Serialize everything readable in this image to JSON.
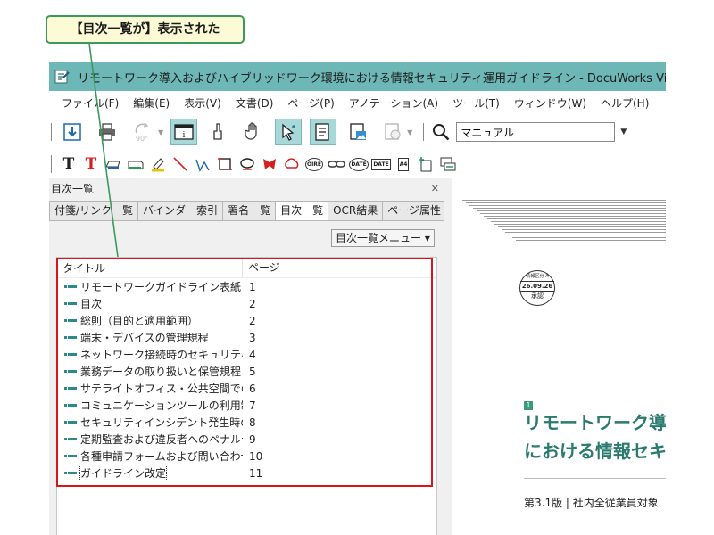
{
  "callout": {
    "text": "【目次一覧が】表示された"
  },
  "window": {
    "title": "リモートワーク導入およびハイブリッドワーク環境における情報セキュリティ運用ガイドライン - DocuWorks Viewer"
  },
  "menu": [
    {
      "label": "ファイル(F)"
    },
    {
      "label": "編集(E)"
    },
    {
      "label": "表示(V)"
    },
    {
      "label": "文書(D)"
    },
    {
      "label": "ページ(P)"
    },
    {
      "label": "アノテーション(A)"
    },
    {
      "label": "ツール(T)"
    },
    {
      "label": "ウィンドウ(W)"
    },
    {
      "label": "ヘルプ(H)"
    }
  ],
  "toolbar": {
    "rotate_label": "90°",
    "search_value": "マニュアル"
  },
  "annotation_toolbar": {
    "text_tool_1": "T",
    "text_tool_2": "T",
    "stamp_1": "OIRE",
    "stamp_2": "DATE",
    "stamp_3": "DATE",
    "paper_size": "A4"
  },
  "panel": {
    "title": "目次一覧",
    "close_glyph": "✕",
    "tabs": [
      {
        "label": "付箋/リンク一覧"
      },
      {
        "label": "バインダー索引"
      },
      {
        "label": "署名一覧"
      },
      {
        "label": "目次一覧"
      },
      {
        "label": "OCR結果"
      },
      {
        "label": "ページ属性"
      }
    ],
    "menu_button": "目次一覧メニュー ▾",
    "columns": {
      "title": "タイトル",
      "page": "ページ"
    },
    "rows": [
      {
        "title": "リモートワークガイドライン表紙",
        "page": "1"
      },
      {
        "title": "目次",
        "page": "2"
      },
      {
        "title": "総則（目的と適用範囲）",
        "page": "2"
      },
      {
        "title": "端末・デバイスの管理規程",
        "page": "3"
      },
      {
        "title": "ネットワーク接続時のセキュリティルール",
        "page": "4"
      },
      {
        "title": "業務データの取り扱いと保管規程",
        "page": "5"
      },
      {
        "title": "サテライトオフィス・公共空間での禁...",
        "page": "6"
      },
      {
        "title": "コミュニケーションツールの利用制限",
        "page": "7"
      },
      {
        "title": "セキュリティインシデント発生時の初...",
        "page": "8"
      },
      {
        "title": "定期監査および違反者へのペナルティ",
        "page": "9"
      },
      {
        "title": "各種申請フォームおよび問い合わせ先",
        "page": "10"
      },
      {
        "title": "ガイドライン改定",
        "page": "11"
      }
    ]
  },
  "preview": {
    "stamp_top": "情報区分 A",
    "stamp_date": "26.09.26",
    "stamp_name": "承認",
    "section_number": "1",
    "title_line1": "リモートワーク導",
    "title_line2": "における情報セキ",
    "subtitle": "第3.1版 | 社内全従業員対象"
  },
  "colors": {
    "titlebar": "#6eb7b7",
    "active_button": "#a9d8d8",
    "highlight": "#d8141f",
    "callout_border": "#3a9a5c",
    "callout_fill": "#fdfbd6",
    "doc_title": "#2a7a6e"
  }
}
